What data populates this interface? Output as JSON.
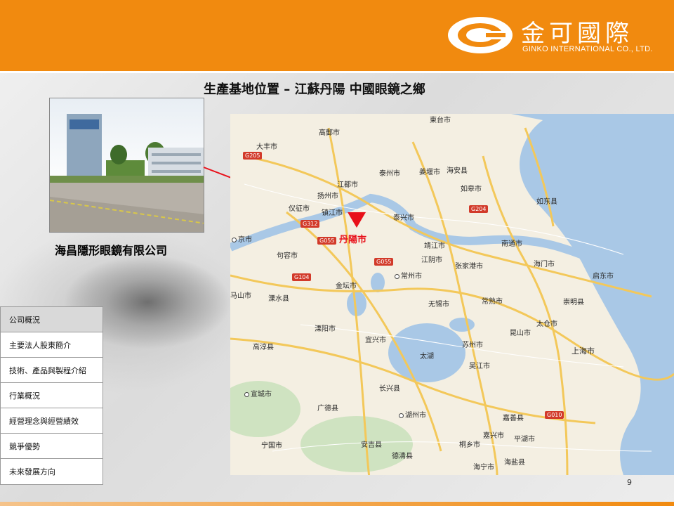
{
  "header": {
    "company_zh": "金可國際",
    "company_en": "GINKO INTERNATIONAL CO., LTD."
  },
  "slide": {
    "title": "生產基地位置 – 江蘇丹陽  中國眼鏡之鄉",
    "page_number": "9"
  },
  "photo": {
    "caption": "海昌隱形眼鏡有限公司"
  },
  "map": {
    "highlight_city": "丹陽市",
    "labels": [
      "高郵市",
      "東台市",
      "大丰市",
      "泰州市",
      "姜堰市",
      "海安县",
      "江都市",
      "扬州市",
      "如皋市",
      "仪征市",
      "镇江市",
      "泰兴市",
      "如东县",
      "京市",
      "句容市",
      "靖江市",
      "南通市",
      "江阴市",
      "张家港市",
      "海门市",
      "启东市",
      "常州市",
      "金坛市",
      "溧水县",
      "无锡市",
      "常熟市",
      "太仓市",
      "崇明县",
      "溧阳市",
      "宜兴市",
      "昆山市",
      "高淳县",
      "太湖",
      "苏州市",
      "上海市",
      "吴江市",
      "宣城市",
      "长兴县",
      "广德县",
      "湖州市",
      "嘉善县",
      "宁国市",
      "安吉县",
      "嘉兴市",
      "平湖市",
      "桐乡市",
      "德清县",
      "海盐县",
      "海宁市",
      "马山市"
    ],
    "roads": [
      "G205",
      "G312",
      "G055",
      "G055",
      "G104",
      "G204",
      "G010"
    ]
  },
  "nav": {
    "items": [
      "公司概況",
      "主要法人股東簡介",
      "技術、產品與製程介紹",
      "行業概況",
      "經營理念與經營績效",
      "競爭優勢",
      "未來發展方向"
    ],
    "active_index": 0
  },
  "colors": {
    "brand_orange": "#f18a0f",
    "marker_red": "#e8101a"
  },
  "icons": {
    "logo": "ginko-logo-icon",
    "location": "red-triangle-marker-icon"
  }
}
